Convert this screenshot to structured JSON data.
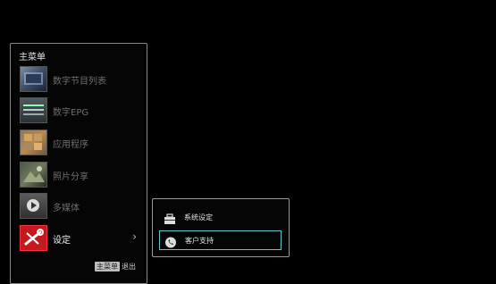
{
  "main_menu": {
    "title": "主菜单",
    "items": [
      {
        "label": "数字节目列表",
        "icon": "digital-channel-list-icon"
      },
      {
        "label": "数字EPG",
        "icon": "epg-icon"
      },
      {
        "label": "应用程序",
        "icon": "applications-icon"
      },
      {
        "label": "照片分享",
        "icon": "photo-share-icon"
      },
      {
        "label": "多媒体",
        "icon": "multimedia-icon"
      },
      {
        "label": "设定",
        "icon": "settings-tools-icon",
        "chevron": "›"
      }
    ],
    "footer": {
      "key_label": "主菜单",
      "action_label": "退出"
    }
  },
  "sub_menu": {
    "items": [
      {
        "label": "系统设定",
        "icon": "toolbox-icon"
      },
      {
        "label": "客户支持",
        "icon": "phone-icon",
        "selected": true
      }
    ]
  },
  "colors": {
    "background": "#000000",
    "border": "#8a8a8a",
    "active_text": "#f0f0f0",
    "inactive_text": "#6f6f6f",
    "selection": "#5fc3c8",
    "settings_accent": "#c6191f"
  }
}
